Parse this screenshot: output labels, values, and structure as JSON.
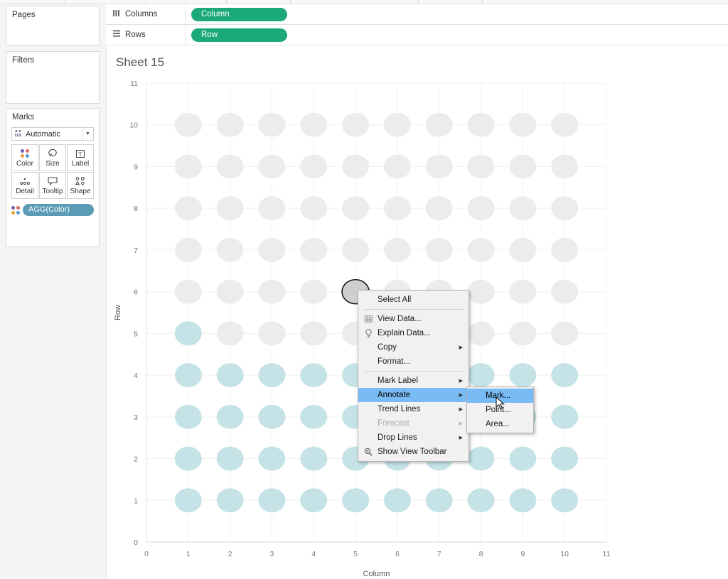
{
  "app": {
    "sheet_title": "Sheet 15"
  },
  "left_panel": {
    "pages_label": "Pages",
    "filters_label": "Filters",
    "marks_label": "Marks",
    "mark_type": "Automatic",
    "mark_type_icon": "automatic-marks-icon",
    "caret_icon": "chevron-down-icon",
    "buttons": [
      {
        "label": "Color",
        "icon": "color-dots-icon"
      },
      {
        "label": "Size",
        "icon": "size-circle-icon"
      },
      {
        "label": "Label",
        "icon": "label-text-icon"
      },
      {
        "label": "Detail",
        "icon": "detail-dots-icon"
      },
      {
        "label": "Tooltip",
        "icon": "tooltip-balloon-icon"
      },
      {
        "label": "Shape",
        "icon": "shape-glyphs-icon"
      }
    ],
    "color_pill": {
      "label": "AGG(Color)",
      "icon": "color-dots-icon",
      "color": "#5b9bb5"
    }
  },
  "shelves": [
    {
      "name": "Columns",
      "icon": "columns-icon",
      "pill": "Column",
      "pill_color": "#1ba97b"
    },
    {
      "name": "Rows",
      "icon": "rows-icon",
      "pill": "Row",
      "pill_color": "#1ba97b"
    }
  ],
  "context_menu": {
    "items": [
      {
        "label": "Select All",
        "icon": null,
        "submenu": false,
        "disabled": false,
        "highlighted": false,
        "separator_after": true
      },
      {
        "label": "View Data...",
        "icon": "table-icon",
        "submenu": false,
        "disabled": false,
        "highlighted": false,
        "separator_after": false
      },
      {
        "label": "Explain Data...",
        "icon": "lightbulb-icon",
        "submenu": false,
        "disabled": false,
        "highlighted": false,
        "separator_after": false
      },
      {
        "label": "Copy",
        "icon": null,
        "submenu": true,
        "disabled": false,
        "highlighted": false,
        "separator_after": false
      },
      {
        "label": "Format...",
        "icon": null,
        "submenu": false,
        "disabled": false,
        "highlighted": false,
        "separator_after": true
      },
      {
        "label": "Mark Label",
        "icon": null,
        "submenu": true,
        "disabled": false,
        "highlighted": false,
        "separator_after": false
      },
      {
        "label": "Annotate",
        "icon": null,
        "submenu": true,
        "disabled": false,
        "highlighted": true,
        "separator_after": false
      },
      {
        "label": "Trend Lines",
        "icon": null,
        "submenu": true,
        "disabled": false,
        "highlighted": false,
        "separator_after": false
      },
      {
        "label": "Forecast",
        "icon": null,
        "submenu": true,
        "disabled": true,
        "highlighted": false,
        "separator_after": false
      },
      {
        "label": "Drop Lines",
        "icon": null,
        "submenu": true,
        "disabled": false,
        "highlighted": false,
        "separator_after": false
      },
      {
        "label": "Show View Toolbar",
        "icon": "magnifier-icon",
        "submenu": false,
        "disabled": false,
        "highlighted": false,
        "separator_after": false
      }
    ],
    "highlight_color": "#79bcf5"
  },
  "submenu": {
    "items": [
      {
        "label": "Mark...",
        "highlighted": true
      },
      {
        "label": "Point...",
        "highlighted": false
      },
      {
        "label": "Area...",
        "highlighted": false
      }
    ]
  },
  "chart_data": {
    "type": "scatter",
    "title": "Sheet 15",
    "xlabel": "Column",
    "ylabel": "Row",
    "xlim": [
      0,
      11
    ],
    "ylim": [
      0,
      11
    ],
    "xticks": [
      0,
      1,
      2,
      3,
      4,
      5,
      6,
      7,
      8,
      9,
      10,
      11
    ],
    "yticks": [
      0,
      1,
      2,
      3,
      4,
      5,
      6,
      7,
      8,
      9,
      10,
      11
    ],
    "grid": true,
    "legend": "none",
    "mark_gray_color": "#ececec",
    "mark_blue_color": "#c5e3e6",
    "selected_mark": {
      "x": 5,
      "y": 6
    },
    "points": [
      {
        "x": 1,
        "y": 1,
        "color": "blue"
      },
      {
        "x": 2,
        "y": 1,
        "color": "blue"
      },
      {
        "x": 3,
        "y": 1,
        "color": "blue"
      },
      {
        "x": 4,
        "y": 1,
        "color": "blue"
      },
      {
        "x": 5,
        "y": 1,
        "color": "blue"
      },
      {
        "x": 6,
        "y": 1,
        "color": "blue"
      },
      {
        "x": 7,
        "y": 1,
        "color": "blue"
      },
      {
        "x": 8,
        "y": 1,
        "color": "blue"
      },
      {
        "x": 9,
        "y": 1,
        "color": "blue"
      },
      {
        "x": 10,
        "y": 1,
        "color": "blue"
      },
      {
        "x": 1,
        "y": 2,
        "color": "blue"
      },
      {
        "x": 2,
        "y": 2,
        "color": "blue"
      },
      {
        "x": 3,
        "y": 2,
        "color": "blue"
      },
      {
        "x": 4,
        "y": 2,
        "color": "blue"
      },
      {
        "x": 5,
        "y": 2,
        "color": "blue"
      },
      {
        "x": 6,
        "y": 2,
        "color": "blue"
      },
      {
        "x": 7,
        "y": 2,
        "color": "blue"
      },
      {
        "x": 8,
        "y": 2,
        "color": "blue"
      },
      {
        "x": 9,
        "y": 2,
        "color": "blue"
      },
      {
        "x": 10,
        "y": 2,
        "color": "blue"
      },
      {
        "x": 1,
        "y": 3,
        "color": "blue"
      },
      {
        "x": 2,
        "y": 3,
        "color": "blue"
      },
      {
        "x": 3,
        "y": 3,
        "color": "blue"
      },
      {
        "x": 4,
        "y": 3,
        "color": "blue"
      },
      {
        "x": 5,
        "y": 3,
        "color": "blue"
      },
      {
        "x": 6,
        "y": 3,
        "color": "blue"
      },
      {
        "x": 7,
        "y": 3,
        "color": "blue"
      },
      {
        "x": 8,
        "y": 3,
        "color": "blue"
      },
      {
        "x": 9,
        "y": 3,
        "color": "blue"
      },
      {
        "x": 10,
        "y": 3,
        "color": "blue"
      },
      {
        "x": 1,
        "y": 4,
        "color": "blue"
      },
      {
        "x": 2,
        "y": 4,
        "color": "blue"
      },
      {
        "x": 3,
        "y": 4,
        "color": "blue"
      },
      {
        "x": 4,
        "y": 4,
        "color": "blue"
      },
      {
        "x": 5,
        "y": 4,
        "color": "blue"
      },
      {
        "x": 6,
        "y": 4,
        "color": "blue"
      },
      {
        "x": 7,
        "y": 4,
        "color": "blue"
      },
      {
        "x": 8,
        "y": 4,
        "color": "blue"
      },
      {
        "x": 9,
        "y": 4,
        "color": "blue"
      },
      {
        "x": 10,
        "y": 4,
        "color": "blue"
      },
      {
        "x": 1,
        "y": 5,
        "color": "blue"
      },
      {
        "x": 2,
        "y": 5,
        "color": "gray"
      },
      {
        "x": 3,
        "y": 5,
        "color": "gray"
      },
      {
        "x": 4,
        "y": 5,
        "color": "gray"
      },
      {
        "x": 5,
        "y": 5,
        "color": "gray"
      },
      {
        "x": 6,
        "y": 5,
        "color": "gray"
      },
      {
        "x": 7,
        "y": 5,
        "color": "gray"
      },
      {
        "x": 8,
        "y": 5,
        "color": "gray"
      },
      {
        "x": 9,
        "y": 5,
        "color": "gray"
      },
      {
        "x": 10,
        "y": 5,
        "color": "gray"
      },
      {
        "x": 1,
        "y": 6,
        "color": "gray"
      },
      {
        "x": 2,
        "y": 6,
        "color": "gray"
      },
      {
        "x": 3,
        "y": 6,
        "color": "gray"
      },
      {
        "x": 4,
        "y": 6,
        "color": "gray"
      },
      {
        "x": 5,
        "y": 6,
        "color": "gray"
      },
      {
        "x": 6,
        "y": 6,
        "color": "gray"
      },
      {
        "x": 7,
        "y": 6,
        "color": "gray"
      },
      {
        "x": 8,
        "y": 6,
        "color": "gray"
      },
      {
        "x": 9,
        "y": 6,
        "color": "gray"
      },
      {
        "x": 10,
        "y": 6,
        "color": "gray"
      },
      {
        "x": 1,
        "y": 7,
        "color": "gray"
      },
      {
        "x": 2,
        "y": 7,
        "color": "gray"
      },
      {
        "x": 3,
        "y": 7,
        "color": "gray"
      },
      {
        "x": 4,
        "y": 7,
        "color": "gray"
      },
      {
        "x": 5,
        "y": 7,
        "color": "gray"
      },
      {
        "x": 6,
        "y": 7,
        "color": "gray"
      },
      {
        "x": 7,
        "y": 7,
        "color": "gray"
      },
      {
        "x": 8,
        "y": 7,
        "color": "gray"
      },
      {
        "x": 9,
        "y": 7,
        "color": "gray"
      },
      {
        "x": 10,
        "y": 7,
        "color": "gray"
      },
      {
        "x": 1,
        "y": 8,
        "color": "gray"
      },
      {
        "x": 2,
        "y": 8,
        "color": "gray"
      },
      {
        "x": 3,
        "y": 8,
        "color": "gray"
      },
      {
        "x": 4,
        "y": 8,
        "color": "gray"
      },
      {
        "x": 5,
        "y": 8,
        "color": "gray"
      },
      {
        "x": 6,
        "y": 8,
        "color": "gray"
      },
      {
        "x": 7,
        "y": 8,
        "color": "gray"
      },
      {
        "x": 8,
        "y": 8,
        "color": "gray"
      },
      {
        "x": 9,
        "y": 8,
        "color": "gray"
      },
      {
        "x": 10,
        "y": 8,
        "color": "gray"
      },
      {
        "x": 1,
        "y": 9,
        "color": "gray"
      },
      {
        "x": 2,
        "y": 9,
        "color": "gray"
      },
      {
        "x": 3,
        "y": 9,
        "color": "gray"
      },
      {
        "x": 4,
        "y": 9,
        "color": "gray"
      },
      {
        "x": 5,
        "y": 9,
        "color": "gray"
      },
      {
        "x": 6,
        "y": 9,
        "color": "gray"
      },
      {
        "x": 7,
        "y": 9,
        "color": "gray"
      },
      {
        "x": 8,
        "y": 9,
        "color": "gray"
      },
      {
        "x": 9,
        "y": 9,
        "color": "gray"
      },
      {
        "x": 10,
        "y": 9,
        "color": "gray"
      },
      {
        "x": 1,
        "y": 10,
        "color": "gray"
      },
      {
        "x": 2,
        "y": 10,
        "color": "gray"
      },
      {
        "x": 3,
        "y": 10,
        "color": "gray"
      },
      {
        "x": 4,
        "y": 10,
        "color": "gray"
      },
      {
        "x": 5,
        "y": 10,
        "color": "gray"
      },
      {
        "x": 6,
        "y": 10,
        "color": "gray"
      },
      {
        "x": 7,
        "y": 10,
        "color": "gray"
      },
      {
        "x": 8,
        "y": 10,
        "color": "gray"
      },
      {
        "x": 9,
        "y": 10,
        "color": "gray"
      },
      {
        "x": 10,
        "y": 10,
        "color": "gray"
      }
    ]
  }
}
